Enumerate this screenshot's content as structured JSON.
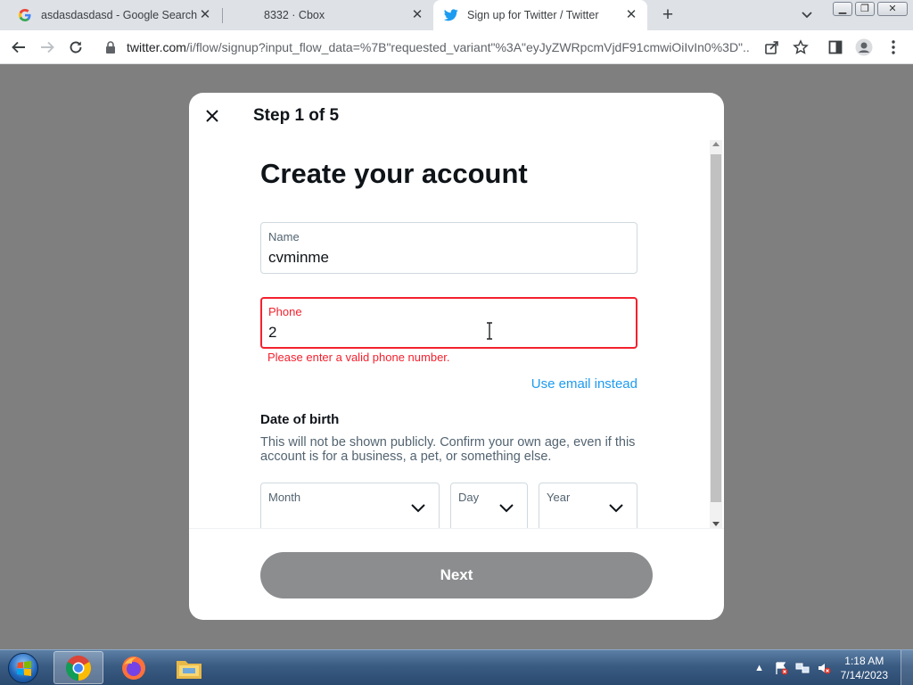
{
  "browser": {
    "tabs": [
      {
        "title": "asdasdasdasd - Google Search",
        "favicon": "google-g-icon",
        "active": false
      },
      {
        "title": "8332 · Cbox",
        "favicon": "none",
        "active": false
      },
      {
        "title": "Sign up for Twitter / Twitter",
        "favicon": "twitter-bird-icon",
        "active": true
      }
    ],
    "new_tab_symbol": "+",
    "close_symbol": "✕",
    "url_host": "twitter.com",
    "url_path": "/i/flow/signup?input_flow_data=%7B\"requested_variant\"%3A\"eyJyZWRpcmVjdF91cmwiOiIvIn0%3D\"..."
  },
  "modal": {
    "step_label": "Step 1 of 5",
    "title": "Create your account",
    "name_field": {
      "label": "Name",
      "value": "cvminme"
    },
    "phone_field": {
      "label": "Phone",
      "value": "2",
      "error": "Please enter a valid phone number."
    },
    "use_email_link": "Use email instead",
    "dob": {
      "title": "Date of birth",
      "description": "This will not be shown publicly. Confirm your own age, even if this account is for a business, a pet, or something else.",
      "month_label": "Month",
      "day_label": "Day",
      "year_label": "Year"
    },
    "next_label": "Next"
  },
  "taskbar": {
    "clock_time": "1:18 AM",
    "clock_date": "7/14/2023",
    "apps": [
      "chrome-icon",
      "firefox-icon",
      "file-explorer-icon"
    ]
  },
  "colors": {
    "accent": "#1d9bf0",
    "error": "#f4212e",
    "next_button_disabled": "#8b8d8f",
    "overlay": "#7f7f7f"
  }
}
